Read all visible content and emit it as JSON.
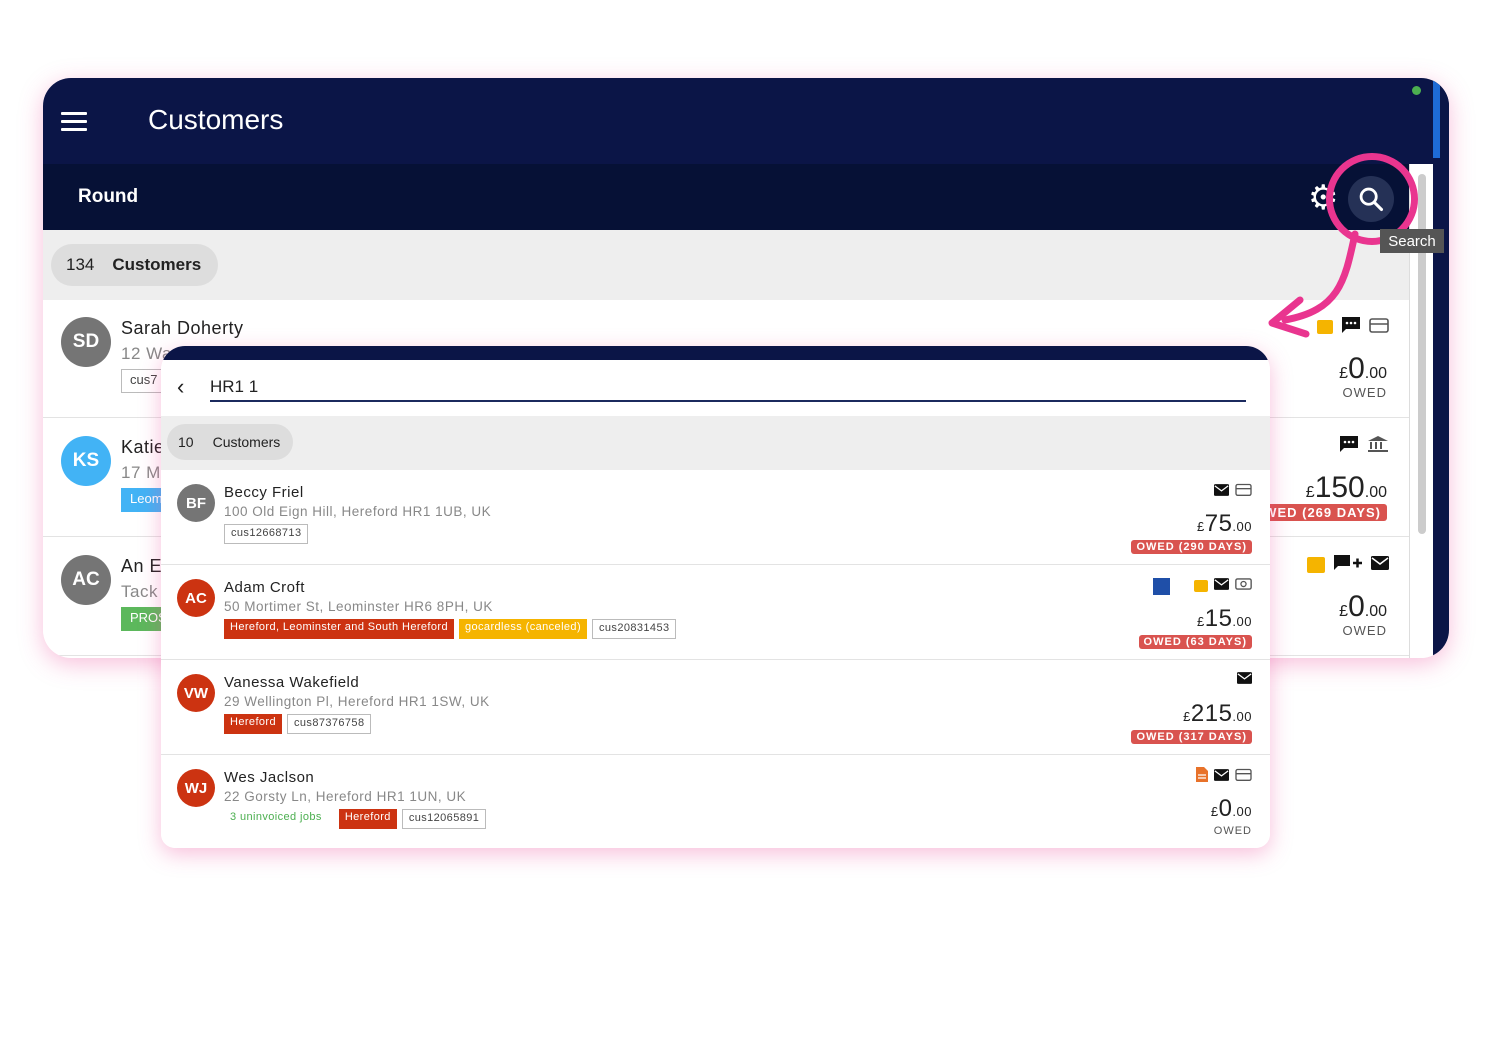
{
  "colors": {
    "navy": "#0b1547",
    "navy_dark": "#061136",
    "highlight": "#e9358f",
    "owed_red": "#d9534f",
    "tag_red": "#cc3311",
    "tag_yellow": "#f5b400"
  },
  "background": {
    "title": "Customers",
    "subtitle": "Round",
    "count": {
      "number": "134",
      "label": "Customers"
    },
    "tooltip": "Search",
    "rows": [
      {
        "initials": "SD",
        "name": "Sarah Doherty",
        "address": "12 Wa",
        "tag": "cus7",
        "amount_prefix": "£",
        "amount_main": "0",
        "amount_cents": ".00",
        "owed": "OWED",
        "avatar_color": "#757575"
      },
      {
        "initials": "KS",
        "name": "Katie",
        "address": "17 M",
        "tag": "Leom",
        "amount_prefix": "£",
        "amount_main": "150",
        "amount_cents": ".00",
        "owed": "WED (269 DAYS)",
        "avatar_color": "#42b3f5"
      },
      {
        "initials": "AC",
        "name": "An E",
        "address": "Tack",
        "tag": "PROS",
        "amount_prefix": "£",
        "amount_main": "0",
        "amount_cents": ".00",
        "owed": "OWED",
        "avatar_color": "#757575"
      }
    ]
  },
  "search": {
    "query": "HR1 1",
    "count": {
      "number": "10",
      "label": "Customers"
    },
    "rows": [
      {
        "initials": "BF",
        "name": "Beccy Friel",
        "address": "100 Old Eign Hill, Hereford HR1 1UB, UK",
        "tags": [
          {
            "text": "cus12668713",
            "style": "plain"
          }
        ],
        "amount_prefix": "£",
        "amount_main": "75",
        "amount_cents": ".00",
        "owed": "OWED (290 DAYS)",
        "avatar_color": "#757575"
      },
      {
        "initials": "AC",
        "name": "Adam Croft",
        "address": "50 Mortimer St, Leominster HR6 8PH, UK",
        "tags": [
          {
            "text": "Hereford, Leominster and South Hereford",
            "style": "red"
          },
          {
            "text": "gocardless (canceled)",
            "style": "yellow"
          },
          {
            "text": "cus20831453",
            "style": "plain"
          }
        ],
        "amount_prefix": "£",
        "amount_main": "15",
        "amount_cents": ".00",
        "owed": "OWED (63 DAYS)",
        "avatar_color": "#cc3311"
      },
      {
        "initials": "VW",
        "name": "Vanessa Wakefield",
        "address": "29 Wellington Pl, Hereford HR1 1SW, UK",
        "tags": [
          {
            "text": "Hereford",
            "style": "red"
          },
          {
            "text": "cus87376758",
            "style": "plain"
          }
        ],
        "amount_prefix": "£",
        "amount_main": "215",
        "amount_cents": ".00",
        "owed": "OWED (317 DAYS)",
        "avatar_color": "#cc3311"
      },
      {
        "initials": "WJ",
        "name": "Wes Jaclson",
        "address": "22 Gorsty Ln, Hereford HR1 1UN, UK",
        "tags": [
          {
            "text": "3 uninvoiced jobs",
            "style": "green"
          },
          {
            "text": "Hereford",
            "style": "red"
          },
          {
            "text": "cus12065891",
            "style": "plain"
          }
        ],
        "amount_prefix": "£",
        "amount_main": "0",
        "amount_cents": ".00",
        "owed": "OWED",
        "avatar_color": "#cc3311"
      }
    ]
  }
}
